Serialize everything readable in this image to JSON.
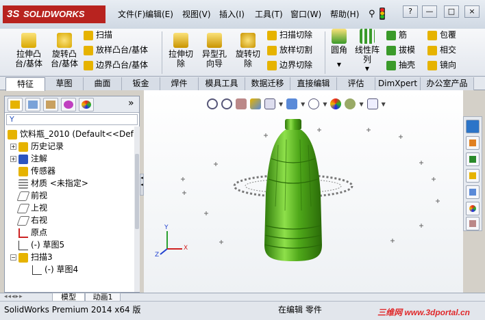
{
  "app": {
    "logo": "SOLIDWORKS",
    "ds_mark": "3S"
  },
  "menu": [
    {
      "label": "文件(F)"
    },
    {
      "label": "编辑(E)"
    },
    {
      "label": "视图(V)"
    },
    {
      "label": "插入(I)"
    },
    {
      "label": "工具(T)"
    },
    {
      "label": "窗口(W)"
    },
    {
      "label": "帮助(H)"
    }
  ],
  "window_controls": {
    "help": "?",
    "minimize": "—",
    "restore": "□",
    "close": "×"
  },
  "commands": {
    "extrude_boss": "拉伸凸\n台/基体",
    "revolve_boss": "旋转凸\n台/基体",
    "sweep": "扫描",
    "loft_boss": "放样凸台/基体",
    "boundary_boss": "边界凸台/基体",
    "extrude_cut": "拉伸切\n除",
    "hole_wizard": "异型孔\n向导",
    "revolve_cut": "旋转切\n除",
    "sweep_cut": "扫描切除",
    "loft_cut": "放样切割",
    "boundary_cut": "边界切除",
    "fillet": "圆角",
    "linear_pattern": "线性阵\n列",
    "rib": "筋",
    "draft": "拔模",
    "shell": "抽壳",
    "wrap": "包覆",
    "intersect": "相交",
    "mirror": "镜向"
  },
  "tabs": [
    {
      "label": "特征",
      "active": true
    },
    {
      "label": "草图"
    },
    {
      "label": "曲面"
    },
    {
      "label": "钣金"
    },
    {
      "label": "焊件"
    },
    {
      "label": "模具工具"
    },
    {
      "label": "数据迁移"
    },
    {
      "label": "直接编辑"
    },
    {
      "label": "评估"
    },
    {
      "label": "DimXpert"
    },
    {
      "label": "办公室产品"
    }
  ],
  "feature_tree": {
    "filter": "Y",
    "more": "»",
    "root": "饮料瓶_2010  (Default<<Def",
    "items": [
      {
        "label": "历史记录",
        "exp": "+"
      },
      {
        "label": "注解",
        "exp": "+"
      },
      {
        "label": "传感器"
      },
      {
        "label": "材质 <未指定>"
      },
      {
        "label": "前视"
      },
      {
        "label": "上视"
      },
      {
        "label": "右视"
      },
      {
        "label": "原点"
      },
      {
        "label": "(-) 草图5"
      },
      {
        "label": "扫描3",
        "exp": "−"
      },
      {
        "label": "(-) 草图4"
      }
    ]
  },
  "bottom_tabs": [
    {
      "label": "模型"
    },
    {
      "label": "动画1"
    }
  ],
  "status": {
    "app_version": "SolidWorks Premium 2014 x64 版",
    "mode": "在编辑 零件",
    "watermark": "三维网 www.3dportal.cn"
  },
  "triad": {
    "y": "Y",
    "x": "X",
    "z": "Z"
  },
  "colors": {
    "model": "#4fa81a",
    "accent_red": "#b8231f",
    "triad_x": "#d02020",
    "triad_y": "#2aa030",
    "triad_z": "#2040d0"
  }
}
